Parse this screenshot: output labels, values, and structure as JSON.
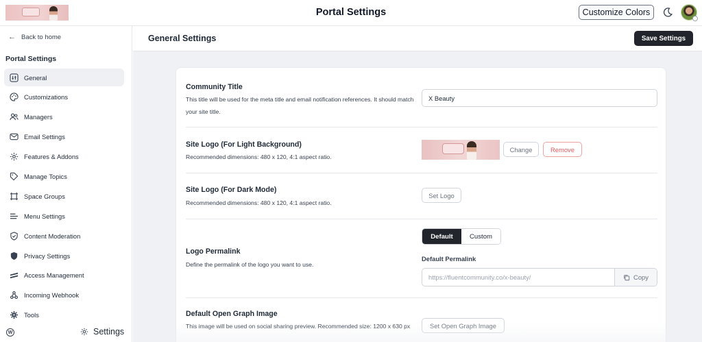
{
  "topbar": {
    "title": "Portal Settings",
    "customize_colors": "Customize Colors",
    "brand_logo_icon": "brand-logo-image",
    "theme_icon": "moon-icon",
    "avatar_icon": "user-avatar"
  },
  "sidebar": {
    "back_label": "Back to home",
    "heading": "Portal Settings",
    "items": [
      {
        "label": "General",
        "icon": "sliders-icon",
        "active": true
      },
      {
        "label": "Customizations",
        "icon": "palette-icon"
      },
      {
        "label": "Managers",
        "icon": "users-icon"
      },
      {
        "label": "Email Settings",
        "icon": "mail-icon"
      },
      {
        "label": "Features & Addons",
        "icon": "gear-icon"
      },
      {
        "label": "Manage Topics",
        "icon": "tag-icon"
      },
      {
        "label": "Space Groups",
        "icon": "grid-icon"
      },
      {
        "label": "Menu Settings",
        "icon": "menu-icon"
      },
      {
        "label": "Content Moderation",
        "icon": "shield-check-icon"
      },
      {
        "label": "Privacy Settings",
        "icon": "shield-icon"
      },
      {
        "label": "Access Management",
        "icon": "stripes-icon"
      },
      {
        "label": "Incoming Webhook",
        "icon": "webhook-icon"
      },
      {
        "label": "Tools",
        "icon": "wrench-gear-icon"
      }
    ],
    "footer": {
      "wp_label": "W",
      "settings_label": "Settings"
    }
  },
  "main": {
    "title": "General Settings",
    "save_label": "Save Settings",
    "community_title": {
      "label": "Community Title",
      "description": "This title will be used for the meta title and email notification references. It should match your site title.",
      "value": "X Beauty"
    },
    "logo_light": {
      "label": "Site Logo (For Light Background)",
      "description": "Recommended dimensions: 480 x 120, 4:1 aspect ratio.",
      "change_label": "Change",
      "remove_label": "Remove"
    },
    "logo_dark": {
      "label": "Site Logo (For Dark Mode)",
      "description": "Recommended dimensions: 480 x 120, 4:1 aspect ratio.",
      "set_label": "Set Logo"
    },
    "permalink": {
      "label": "Logo Permalink",
      "description": "Define the permalink of the logo you want to use.",
      "options": [
        "Default",
        "Custom"
      ],
      "selected": "Default",
      "field_label": "Default Permalink",
      "value": "https://fluentcommunity.co/x-beauty/",
      "copy_label": "Copy"
    },
    "og_image": {
      "label": "Default Open Graph Image",
      "description": "This image will be used on social sharing preview. Recommended size: 1200 x 630 px",
      "set_label": "Set Open Graph Image"
    }
  }
}
